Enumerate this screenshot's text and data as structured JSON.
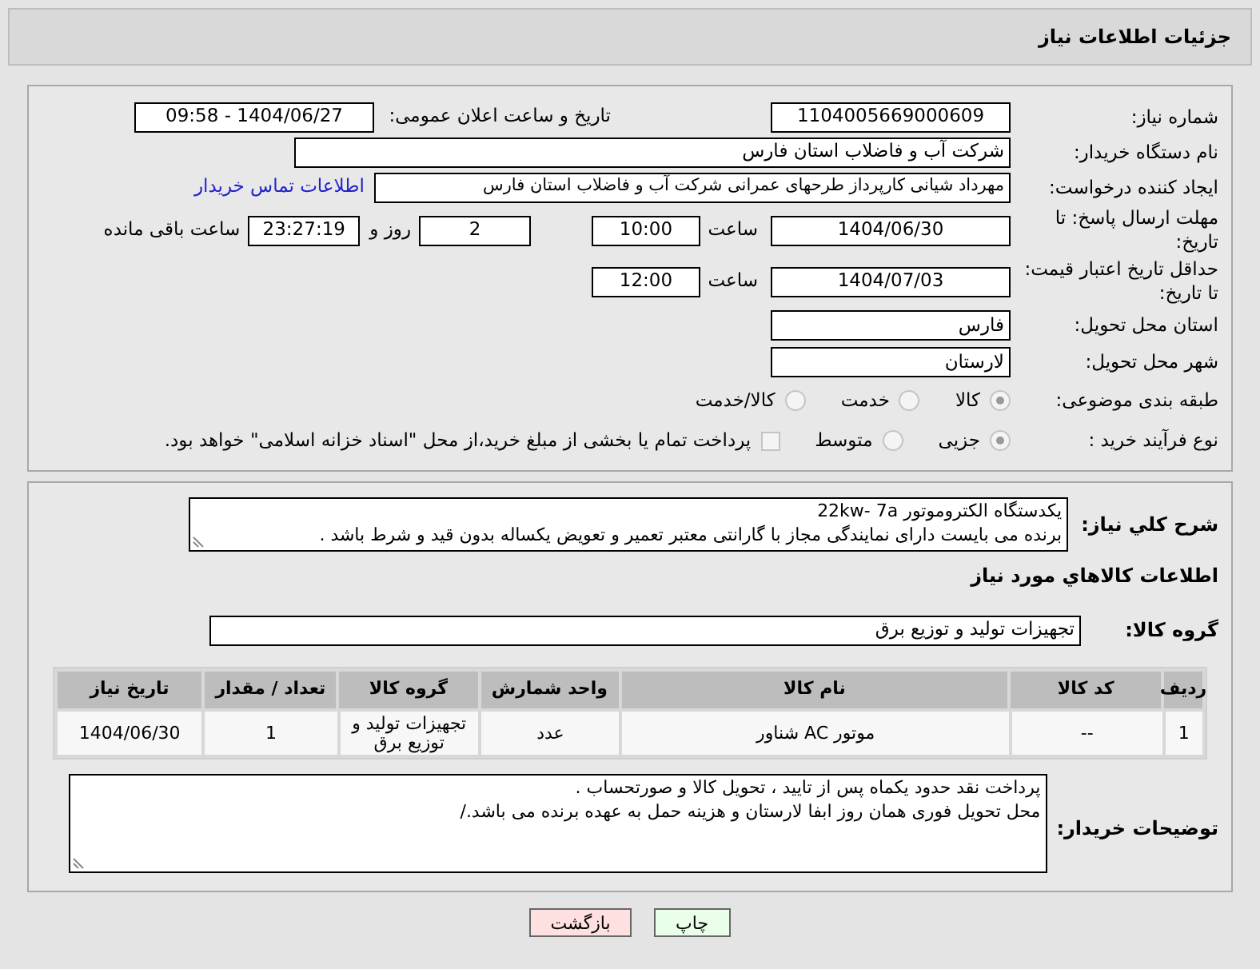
{
  "header": {
    "title": "جزئیات اطلاعات نیاز"
  },
  "need_number": {
    "label": "شماره نیاز:",
    "value": "1104005669000609"
  },
  "announce": {
    "label": "تاریخ و ساعت اعلان عمومی:",
    "value": "1404/06/27 - 09:58"
  },
  "buyer": {
    "label": "نام دستگاه خریدار:",
    "value": "شرکت آب و فاضلاب استان فارس"
  },
  "creator": {
    "label": "ایجاد کننده درخواست:",
    "value": "مهرداد شیانی کارپرداز طرحهای عمرانی  شرکت آب و فاضلاب استان فارس",
    "link": "اطلاعات تماس خریدار"
  },
  "deadline": {
    "label": "مهلت ارسال پاسخ: تا تاریخ:",
    "date": "1404/06/30",
    "time_label": "ساعت",
    "time": "10:00",
    "days": "2",
    "days_label": "روز و",
    "remaining": "23:27:19",
    "remaining_label": "ساعت باقی مانده"
  },
  "validity": {
    "label": "حداقل تاریخ اعتبار قیمت: تا تاریخ:",
    "date": "1404/07/03",
    "time_label": "ساعت",
    "time": "12:00"
  },
  "province": {
    "label": "استان محل تحویل:",
    "value": "فارس"
  },
  "city": {
    "label": "شهر محل تحویل:",
    "value": "لارستان"
  },
  "category": {
    "label": "طبقه بندی موضوعی:",
    "options": [
      {
        "label": "کالا",
        "selected": true
      },
      {
        "label": "خدمت",
        "selected": false
      },
      {
        "label": "کالا/خدمت",
        "selected": false
      }
    ]
  },
  "purchase_type": {
    "label": "نوع فرآیند خرید :",
    "options": [
      {
        "label": "جزیی",
        "selected": true
      },
      {
        "label": "متوسط",
        "selected": false
      }
    ],
    "treasury": {
      "label": "پرداخت تمام یا بخشی از مبلغ خرید،از محل \"اسناد خزانه اسلامی\" خواهد بود.",
      "checked": false
    }
  },
  "description": {
    "label": "شرح کلي نياز:",
    "lines": [
      "یکدستگاه الکتروموتور 22kw- 7a",
      "برنده می بایست دارای نمایندگی مجاز با گارانتی معتبر تعمیر و تعویض یکساله بدون قید و شرط باشد ."
    ]
  },
  "goods_heading": "اطلاعات کالاهاي مورد نياز",
  "goods_group": {
    "label": "گروه کالا:",
    "value": "تجهیزات تولید و توزیع برق"
  },
  "table": {
    "columns": [
      "ردیف",
      "کد کالا",
      "نام کالا",
      "واحد شمارش",
      "گروه کالا",
      "تعداد / مقدار",
      "تاریخ نیاز"
    ],
    "rows": [
      [
        "1",
        "--",
        "موتور AC شناور",
        "عدد",
        "تجهیزات تولید و توزیع برق",
        "1",
        "1404/06/30"
      ]
    ]
  },
  "buyer_notes": {
    "label": "توضیحات خریدار:",
    "lines": [
      "پرداخت نقد حدود یکماه  پس از تایید ، تحویل کالا و صورتحساب .",
      "محل تحویل فوری همان روز ابفا لارستان و هزینه حمل به عهده برنده می باشد./"
    ]
  },
  "buttons": [
    {
      "label": "چاپ",
      "kind": "print"
    },
    {
      "label": "بازگشت",
      "kind": "back"
    }
  ]
}
